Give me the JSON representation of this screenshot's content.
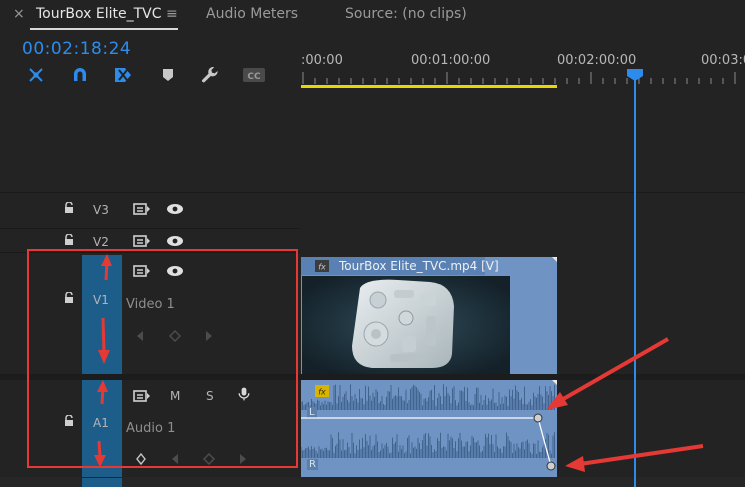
{
  "tabs": {
    "close_glyph": "×",
    "sequence_label": "TourBox Elite_TVC",
    "menu_glyph": "≡",
    "audio_meters_label": "Audio Meters",
    "source_label": "Source: (no clips)"
  },
  "timeline": {
    "timecode": "00:02:18:24",
    "ruler_labels": [
      ":00:00",
      "00:01:00:00",
      "00:02:00:00",
      "00:03:0"
    ],
    "tools": [
      "snap-icon",
      "magnet-icon",
      "linked-selection-icon",
      "marker-icon",
      "wrench-icon",
      "captions-icon"
    ],
    "tool_cc_text": "CC"
  },
  "tracks": {
    "v3": {
      "label": "V3"
    },
    "v2": {
      "label": "V2"
    },
    "v1": {
      "label": "V1",
      "name": "Video 1"
    },
    "a1": {
      "label": "A1",
      "name": "Audio 1",
      "mute": "M",
      "solo": "S"
    }
  },
  "clips": {
    "video": {
      "fx": "fx",
      "name": "TourBox Elite_TVC.mp4 [V]"
    },
    "audio": {
      "fx": "fx",
      "channel_left": "L",
      "channel_right": "R"
    }
  },
  "colors": {
    "accent": "#2d8ceb",
    "clip": "#6f93c3",
    "work_area": "#e8d700",
    "annotation": "#e53935"
  }
}
